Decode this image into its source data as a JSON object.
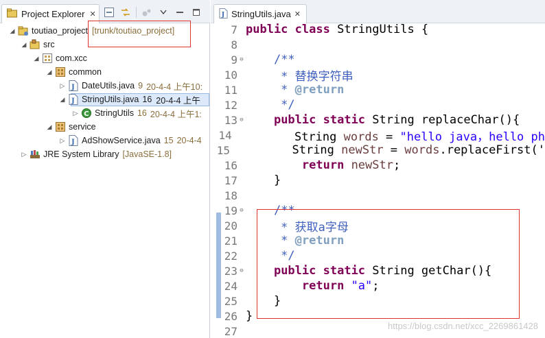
{
  "explorer": {
    "tab_label": "Project Explorer",
    "tree": [
      {
        "name": "toutiao_project",
        "decoration": "[trunk/toutiao_project]",
        "twisty": "◢",
        "icon": "project-icon"
      },
      {
        "name": "src",
        "twisty": "◢",
        "icon": "source-folder-icon"
      },
      {
        "name": "com.xcc",
        "twisty": "◢",
        "icon": "package-icon"
      },
      {
        "name": "common",
        "twisty": "◢",
        "icon": "package-icon"
      },
      {
        "name": "DateUtils.java",
        "revision": "9",
        "date": "20-4-4 上午10:",
        "twisty": "▷",
        "icon": "java-file-icon"
      },
      {
        "name": "StringUtils.java",
        "revision": "16",
        "date": "20-4-4 上午",
        "twisty": "◢",
        "icon": "java-file-icon",
        "selected": true
      },
      {
        "name": "StringUtils",
        "revision": "16",
        "date": "20-4-4 上午1:",
        "twisty": "▷",
        "icon": "class-icon"
      },
      {
        "name": "service",
        "twisty": "◢",
        "icon": "package-icon"
      },
      {
        "name": "AdShowService.java",
        "revision": "15",
        "date": "20-4-4",
        "twisty": "▷",
        "icon": "java-file-icon"
      },
      {
        "name": "JRE System Library",
        "decoration": "[JavaSE-1.8]",
        "twisty": "▷",
        "icon": "library-icon"
      }
    ]
  },
  "editor": {
    "tab_label": "StringUtils.java",
    "lines": [
      {
        "n": "7",
        "fold": "",
        "tokens": [
          {
            "t": "public",
            "c": "kw"
          },
          {
            "t": " "
          },
          {
            "t": "class",
            "c": "kw"
          },
          {
            "t": " StringUtils {"
          }
        ]
      },
      {
        "n": "8",
        "fold": "",
        "tokens": []
      },
      {
        "n": "9",
        "fold": "⊖",
        "tokens": [
          {
            "t": "    "
          },
          {
            "t": "/**",
            "c": "jd"
          }
        ]
      },
      {
        "n": "10",
        "fold": "",
        "tokens": [
          {
            "t": "     * 替换字符串",
            "c": "jd"
          }
        ]
      },
      {
        "n": "11",
        "fold": "",
        "tokens": [
          {
            "t": "     * ",
            "c": "jd"
          },
          {
            "t": "@return",
            "c": "jdt"
          }
        ]
      },
      {
        "n": "12",
        "fold": "",
        "tokens": [
          {
            "t": "     */",
            "c": "jd"
          }
        ]
      },
      {
        "n": "13",
        "fold": "⊖",
        "tokens": [
          {
            "t": "    "
          },
          {
            "t": "public",
            "c": "kw"
          },
          {
            "t": " "
          },
          {
            "t": "static",
            "c": "kw"
          },
          {
            "t": " String replaceChar(){"
          }
        ]
      },
      {
        "n": "14",
        "fold": "",
        "tokens": [
          {
            "t": "        String "
          },
          {
            "t": "words",
            "c": "fld"
          },
          {
            "t": " = "
          },
          {
            "t": "\"hello java，hello ph",
            "c": "str"
          }
        ]
      },
      {
        "n": "15",
        "fold": "",
        "tokens": [
          {
            "t": "        String "
          },
          {
            "t": "newStr",
            "c": "fld"
          },
          {
            "t": " = "
          },
          {
            "t": "words",
            "c": "fld"
          },
          {
            "t": ".replaceFirst('"
          }
        ]
      },
      {
        "n": "16",
        "fold": "",
        "tokens": [
          {
            "t": "        "
          },
          {
            "t": "return",
            "c": "kw"
          },
          {
            "t": " "
          },
          {
            "t": "newStr",
            "c": "fld"
          },
          {
            "t": ";"
          }
        ]
      },
      {
        "n": "17",
        "fold": "",
        "tokens": [
          {
            "t": "    }"
          }
        ]
      },
      {
        "n": "18",
        "fold": "",
        "tokens": []
      },
      {
        "n": "19",
        "fold": "⊖",
        "tokens": [
          {
            "t": "    "
          },
          {
            "t": "/**",
            "c": "jd"
          }
        ]
      },
      {
        "n": "20",
        "fold": "",
        "tokens": [
          {
            "t": "     * 获取a字母",
            "c": "jd"
          }
        ]
      },
      {
        "n": "21",
        "fold": "",
        "tokens": [
          {
            "t": "     * ",
            "c": "jd"
          },
          {
            "t": "@return",
            "c": "jdt"
          }
        ]
      },
      {
        "n": "22",
        "fold": "",
        "tokens": [
          {
            "t": "     */",
            "c": "jd"
          }
        ]
      },
      {
        "n": "23",
        "fold": "⊖",
        "tokens": [
          {
            "t": "    "
          },
          {
            "t": "public",
            "c": "kw"
          },
          {
            "t": " "
          },
          {
            "t": "static",
            "c": "kw"
          },
          {
            "t": " String getChar(){"
          }
        ]
      },
      {
        "n": "24",
        "fold": "",
        "tokens": [
          {
            "t": "        "
          },
          {
            "t": "return",
            "c": "kw"
          },
          {
            "t": " "
          },
          {
            "t": "\"a\"",
            "c": "str"
          },
          {
            "t": ";"
          }
        ]
      },
      {
        "n": "25",
        "fold": "",
        "tokens": [
          {
            "t": "    }"
          }
        ]
      },
      {
        "n": "26",
        "fold": "",
        "tokens": [
          {
            "t": "}"
          }
        ]
      },
      {
        "n": "27",
        "fold": "",
        "tokens": []
      }
    ]
  },
  "watermark": "https://blog.csdn.net/xcc_2269861428",
  "colors": {
    "highlight_box": "#e03030",
    "change_ruler": "#9fbbe0",
    "keyword": "#7f0055",
    "string": "#2a00ff",
    "javadoc": "#3f5fbf"
  }
}
